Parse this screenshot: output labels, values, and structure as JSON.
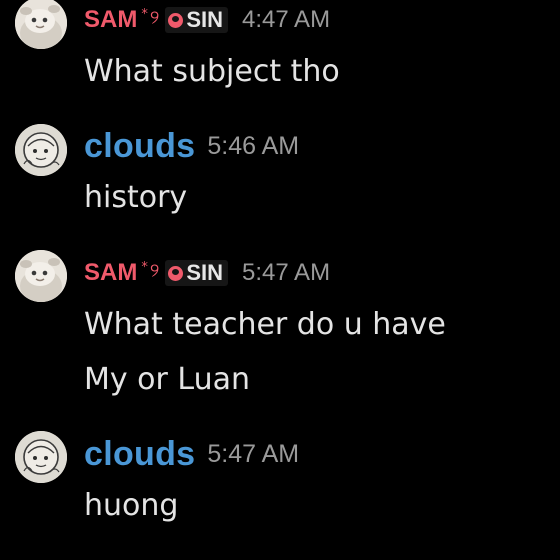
{
  "messages": [
    {
      "author": "SAM",
      "deco_star": "*",
      "deco_swirl": "୨",
      "tag": "SIN",
      "time": "4:47 AM",
      "lines": [
        "What subject tho"
      ]
    },
    {
      "author": "clouds",
      "time": "5:46 AM",
      "lines": [
        "history"
      ]
    },
    {
      "author": "SAM",
      "deco_star": "*",
      "deco_swirl": "୨",
      "tag": "SIN",
      "time": "5:47 AM",
      "lines": [
        "What teacher do u have",
        "My or Luan"
      ]
    },
    {
      "author": "clouds",
      "time": "5:47 AM",
      "lines": [
        "huong"
      ]
    }
  ],
  "colors": {
    "background": "#000000",
    "sam_name": "#f05a6b",
    "clouds_name": "#4a97d6",
    "timestamp": "#9a9a9a",
    "message_text": "#e4e4e4"
  },
  "icons": {
    "sam_avatar": "plush-avatar-icon",
    "clouds_avatar": "sketch-avatar-icon",
    "tag_icon": "red-badge-icon"
  }
}
